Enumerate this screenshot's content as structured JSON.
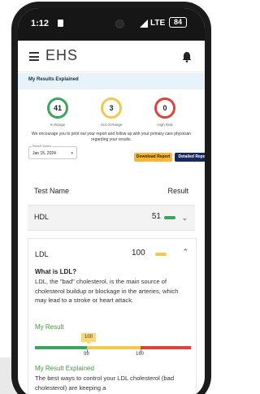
{
  "status_bar": {
    "time": "1:12",
    "network": "LTE",
    "battery": "84"
  },
  "app_bar": {
    "logo_text": "EHS",
    "menu_icon": "hamburger-menu-icon",
    "notification_icon": "bell-icon"
  },
  "banner": {
    "title": "My Results Explained"
  },
  "summary": {
    "in_range": {
      "count": "41",
      "label": "In Range",
      "color": "#3aa55c"
    },
    "out_of_range": {
      "count": "3",
      "label": "Out of Range",
      "color": "#f2c94c"
    },
    "high_risk": {
      "count": "0",
      "label": "High Risk",
      "color": "#d9453a"
    }
  },
  "advice_text": "We encourage you to print out your report and follow up with your primary care physician regarding your results.",
  "result_dates": {
    "label": "Result Dates",
    "value": "Jan 15, 2024"
  },
  "buttons": {
    "download": "Download Report",
    "detailed": "Detailed Report"
  },
  "table": {
    "header_name": "Test Name",
    "header_result": "Result",
    "rows": [
      {
        "name": "HDL",
        "value": "51",
        "status_color": "#3aa55c"
      },
      {
        "name": "LDL",
        "value": "100",
        "status_color": "#f2c94c"
      }
    ]
  },
  "ldl_detail": {
    "question": "What is LDL?",
    "description": "LDL, the \"bad\" cholesterol, is the main source of cholesterol buildup or blockage in the arteries, which may lead to a stroke or heart attack.",
    "my_result_label": "My Result",
    "result_value": "100",
    "threshold_low": "99",
    "threshold_high": "160",
    "explained_label": "My Result Explained",
    "explained_text": "The best ways to control your LDL cholesterol (bad cholesterol) are keeping a"
  }
}
